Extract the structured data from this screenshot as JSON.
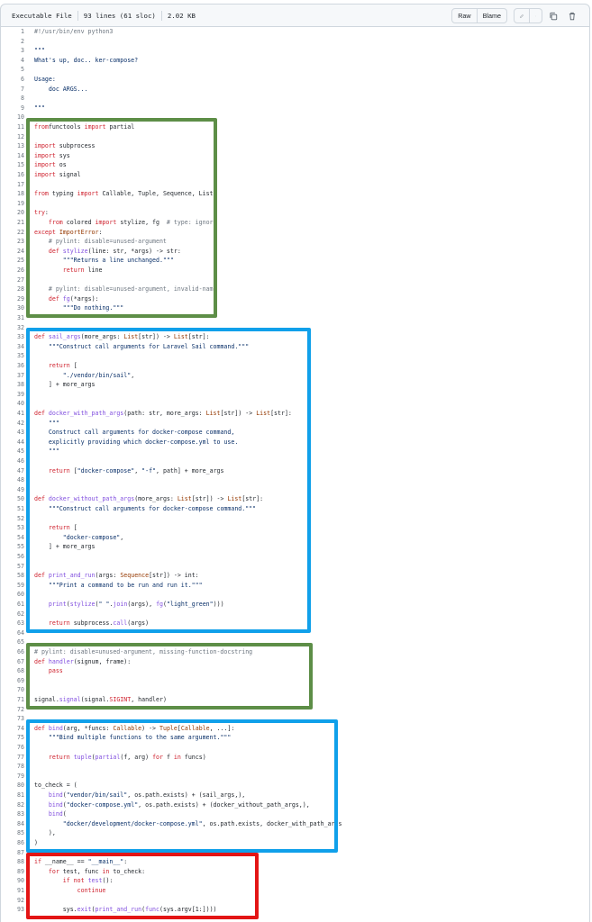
{
  "header": {
    "file_type": "Executable File",
    "line_info": "93 lines (61 sloc)",
    "file_size": "2.02 KB",
    "raw_label": "Raw",
    "blame_label": "Blame",
    "edit_icon": "pencil-icon",
    "dropdown_icon": "triangle-down-icon",
    "copy_icon": "copy-icon",
    "delete_icon": "trash-icon"
  },
  "colors": {
    "keyword": "#cf222e",
    "function": "#8250df",
    "string": "#0a3069",
    "comment": "#6e7781",
    "builtin_type": "#953800",
    "highlight_green": "#5d8e47",
    "highlight_blue": "#10a0ea",
    "highlight_red": "#e31515"
  },
  "code": {
    "lines": [
      [
        [
          "cm",
          "#!/usr/bin/env python3"
        ]
      ],
      [],
      [
        [
          "st",
          "\"\"\""
        ]
      ],
      [
        [
          "st",
          "What's up, doc.. ker-compose?"
        ]
      ],
      [],
      [
        [
          "st",
          "Usage:"
        ]
      ],
      [
        [
          "st",
          "    doc ARGS..."
        ]
      ],
      [],
      [
        [
          "st",
          "\"\"\""
        ]
      ],
      [],
      [
        [
          "kw",
          "from"
        ],
        [
          "",
          "functools "
        ],
        [
          "kw",
          "import"
        ],
        [
          "",
          " partial"
        ]
      ],
      [],
      [
        [
          "kw",
          "import"
        ],
        [
          "",
          " subprocess"
        ]
      ],
      [
        [
          "kw",
          "import"
        ],
        [
          "",
          " sys"
        ]
      ],
      [
        [
          "kw",
          "import"
        ],
        [
          "",
          " os"
        ]
      ],
      [
        [
          "kw",
          "import"
        ],
        [
          "",
          " signal"
        ]
      ],
      [],
      [
        [
          "kw",
          "from"
        ],
        [
          "",
          " typing "
        ],
        [
          "kw",
          "import"
        ],
        [
          "",
          " Callable, Tuple, Sequence, List"
        ]
      ],
      [],
      [
        [
          "kw",
          "try"
        ],
        [
          "",
          ":"
        ]
      ],
      [
        [
          "",
          "    "
        ],
        [
          "kw",
          "from"
        ],
        [
          "",
          " colored "
        ],
        [
          "kw",
          "import"
        ],
        [
          "",
          " stylize, fg  "
        ],
        [
          "cm",
          "# type: ignore"
        ]
      ],
      [
        [
          "kw",
          "except"
        ],
        [
          "",
          " "
        ],
        [
          "bi",
          "ImportError"
        ],
        [
          "",
          ":"
        ]
      ],
      [
        [
          "",
          "    "
        ],
        [
          "cm",
          "# pylint: disable=unused-argument"
        ]
      ],
      [
        [
          "",
          "    "
        ],
        [
          "kw",
          "def"
        ],
        [
          "",
          " "
        ],
        [
          "fn",
          "stylize"
        ],
        [
          "",
          "(line: str, *args) -> str:"
        ]
      ],
      [
        [
          "",
          "        "
        ],
        [
          "st",
          "\"\"\"Returns a line unchanged.\"\"\""
        ]
      ],
      [
        [
          "",
          "        "
        ],
        [
          "kw",
          "return"
        ],
        [
          "",
          " line"
        ]
      ],
      [],
      [
        [
          "",
          "    "
        ],
        [
          "cm",
          "# pylint: disable=unused-argument, invalid-name"
        ]
      ],
      [
        [
          "",
          "    "
        ],
        [
          "kw",
          "def"
        ],
        [
          "",
          " "
        ],
        [
          "fn",
          "fg"
        ],
        [
          "",
          "(*args):"
        ]
      ],
      [
        [
          "",
          "        "
        ],
        [
          "st",
          "\"\"\"Do nothing.\"\"\""
        ]
      ],
      [],
      [],
      [
        [
          "kw",
          "def"
        ],
        [
          "",
          " "
        ],
        [
          "fn",
          "sail_args"
        ],
        [
          "",
          "(more_args: "
        ],
        [
          "bi",
          "List"
        ],
        [
          "",
          "[str]) -> "
        ],
        [
          "bi",
          "List"
        ],
        [
          "",
          "[str]:"
        ]
      ],
      [
        [
          "",
          "    "
        ],
        [
          "st",
          "\"\"\"Construct call arguments for Laravel Sail command.\"\"\""
        ]
      ],
      [],
      [
        [
          "",
          "    "
        ],
        [
          "kw",
          "return"
        ],
        [
          "",
          " ["
        ]
      ],
      [
        [
          "",
          "        "
        ],
        [
          "st",
          "\"./vendor/bin/sail\""
        ],
        [
          "",
          ","
        ]
      ],
      [
        [
          "",
          "    ] + more_args"
        ]
      ],
      [],
      [],
      [
        [
          "kw",
          "def"
        ],
        [
          "",
          " "
        ],
        [
          "fn",
          "docker_with_path_args"
        ],
        [
          "",
          "(path: str, more_args: "
        ],
        [
          "bi",
          "List"
        ],
        [
          "",
          "[str]) -> "
        ],
        [
          "bi",
          "List"
        ],
        [
          "",
          "[str]:"
        ]
      ],
      [
        [
          "",
          "    "
        ],
        [
          "st",
          "\"\"\""
        ]
      ],
      [
        [
          "",
          "    "
        ],
        [
          "st",
          "Construct call arguments for docker-compose command,"
        ]
      ],
      [
        [
          "",
          "    "
        ],
        [
          "st",
          "explicitly providing which docker-compose.yml to use."
        ]
      ],
      [
        [
          "",
          "    "
        ],
        [
          "st",
          "\"\"\""
        ]
      ],
      [],
      [
        [
          "",
          "    "
        ],
        [
          "kw",
          "return"
        ],
        [
          "",
          " ["
        ],
        [
          "st",
          "\"docker-compose\""
        ],
        [
          "",
          ", "
        ],
        [
          "st",
          "\"-f\""
        ],
        [
          "",
          ", path] + more_args"
        ]
      ],
      [],
      [],
      [
        [
          "kw",
          "def"
        ],
        [
          "",
          " "
        ],
        [
          "fn",
          "docker_without_path_args"
        ],
        [
          "",
          "(more_args: "
        ],
        [
          "bi",
          "List"
        ],
        [
          "",
          "[str]) -> "
        ],
        [
          "bi",
          "List"
        ],
        [
          "",
          "[str]:"
        ]
      ],
      [
        [
          "",
          "    "
        ],
        [
          "st",
          "\"\"\"Construct call arguments for docker-compose command.\"\"\""
        ]
      ],
      [],
      [
        [
          "",
          "    "
        ],
        [
          "kw",
          "return"
        ],
        [
          "",
          " ["
        ]
      ],
      [
        [
          "",
          "        "
        ],
        [
          "st",
          "\"docker-compose\""
        ],
        [
          "",
          ","
        ]
      ],
      [
        [
          "",
          "    ] + more_args"
        ]
      ],
      [],
      [],
      [
        [
          "kw",
          "def"
        ],
        [
          "",
          " "
        ],
        [
          "fn",
          "print_and_run"
        ],
        [
          "",
          "(args: "
        ],
        [
          "bi",
          "Sequence"
        ],
        [
          "",
          "[str]) -> int:"
        ]
      ],
      [
        [
          "",
          "    "
        ],
        [
          "st",
          "\"\"\"Print a command to be run and run it.\"\"\""
        ]
      ],
      [],
      [
        [
          "",
          "    "
        ],
        [
          "fn",
          "print"
        ],
        [
          "",
          "("
        ],
        [
          "fn",
          "stylize"
        ],
        [
          "",
          "("
        ],
        [
          "st",
          "\" \""
        ],
        [
          "",
          "."
        ],
        [
          "fn",
          "join"
        ],
        [
          "",
          "(args), "
        ],
        [
          "fn",
          "fg"
        ],
        [
          "",
          "("
        ],
        [
          "st",
          "\"light_green\""
        ],
        [
          "",
          ")))"
        ]
      ],
      [],
      [
        [
          "",
          "    "
        ],
        [
          "kw",
          "return"
        ],
        [
          "",
          " subprocess."
        ],
        [
          "fn",
          "call"
        ],
        [
          "",
          "(args)"
        ]
      ],
      [],
      [],
      [
        [
          "cm",
          "# pylint: disable=unused-argument, missing-function-docstring"
        ]
      ],
      [
        [
          "kw",
          "def"
        ],
        [
          "",
          " "
        ],
        [
          "fn",
          "handler"
        ],
        [
          "",
          "(signum, frame):"
        ]
      ],
      [
        [
          "",
          "    "
        ],
        [
          "kw",
          "pass"
        ]
      ],
      [],
      [],
      [
        [
          "",
          "signal."
        ],
        [
          "fn",
          "signal"
        ],
        [
          "",
          "(signal."
        ],
        [
          "kw",
          "SIGINT"
        ],
        [
          "",
          ", handler)"
        ]
      ],
      [],
      [],
      [
        [
          "kw",
          "def"
        ],
        [
          "",
          " "
        ],
        [
          "fn",
          "bind"
        ],
        [
          "",
          "(arg, *funcs: "
        ],
        [
          "bi",
          "Callable"
        ],
        [
          "",
          ") -> "
        ],
        [
          "bi",
          "Tuple"
        ],
        [
          "",
          "["
        ],
        [
          "bi",
          "Callable"
        ],
        [
          "",
          ", ...]:"
        ]
      ],
      [
        [
          "",
          "    "
        ],
        [
          "st",
          "\"\"\"Bind multiple functions to the same argument.\"\"\""
        ]
      ],
      [],
      [
        [
          "",
          "    "
        ],
        [
          "kw",
          "return"
        ],
        [
          "",
          " "
        ],
        [
          "fn",
          "tuple"
        ],
        [
          "",
          "("
        ],
        [
          "fn",
          "partial"
        ],
        [
          "",
          "(f, arg) "
        ],
        [
          "kw",
          "for"
        ],
        [
          "",
          " f "
        ],
        [
          "kw",
          "in"
        ],
        [
          "",
          " funcs)"
        ]
      ],
      [],
      [],
      [
        [
          "",
          "to_check = ("
        ]
      ],
      [
        [
          "",
          "    "
        ],
        [
          "fn",
          "bind"
        ],
        [
          "",
          "("
        ],
        [
          "st",
          "\"vendor/bin/sail\""
        ],
        [
          "",
          ", os.path.exists) + (sail_args,),"
        ]
      ],
      [
        [
          "",
          "    "
        ],
        [
          "fn",
          "bind"
        ],
        [
          "",
          "("
        ],
        [
          "st",
          "\"docker-compose.yml\""
        ],
        [
          "",
          ", os.path.exists) + (docker_without_path_args,),"
        ]
      ],
      [
        [
          "",
          "    "
        ],
        [
          "fn",
          "bind"
        ],
        [
          "",
          "("
        ]
      ],
      [
        [
          "",
          "        "
        ],
        [
          "st",
          "\"docker/development/docker-compose.yml\""
        ],
        [
          "",
          ", os.path.exists, docker_with_path_args"
        ]
      ],
      [
        [
          "",
          "    ),"
        ]
      ],
      [
        [
          "",
          ")"
        ]
      ],
      [],
      [
        [
          "kw",
          "if"
        ],
        [
          "",
          " __name__ == "
        ],
        [
          "st",
          "\"__main__\""
        ],
        [
          "",
          ":"
        ]
      ],
      [
        [
          "",
          "    "
        ],
        [
          "kw",
          "for"
        ],
        [
          "",
          " test, func "
        ],
        [
          "kw",
          "in"
        ],
        [
          "",
          " to_check:"
        ]
      ],
      [
        [
          "",
          "        "
        ],
        [
          "kw",
          "if not"
        ],
        [
          "",
          " "
        ],
        [
          "fn",
          "test"
        ],
        [
          "",
          "():"
        ]
      ],
      [
        [
          "",
          "            "
        ],
        [
          "kw",
          "continue"
        ]
      ],
      [],
      [
        [
          "",
          "        sys."
        ],
        [
          "fn",
          "exit"
        ],
        [
          "",
          "("
        ],
        [
          "fn",
          "print_and_run"
        ],
        [
          "",
          "("
        ],
        [
          "fn",
          "func"
        ],
        [
          "",
          "(sys.argv[1:])))"
        ]
      ]
    ]
  },
  "highlights": [
    {
      "name": "highlight-imports-green",
      "color": "green",
      "from_line": 11,
      "to_line": 30
    },
    {
      "name": "highlight-helpers-blue",
      "color": "blue",
      "from_line": 33,
      "to_line": 63
    },
    {
      "name": "highlight-handler-green",
      "color": "green",
      "from_line": 66,
      "to_line": 71
    },
    {
      "name": "highlight-bind-blue",
      "color": "blue",
      "from_line": 74,
      "to_line": 86
    },
    {
      "name": "highlight-main-red",
      "color": "red",
      "from_line": 88,
      "to_line": 93
    }
  ]
}
